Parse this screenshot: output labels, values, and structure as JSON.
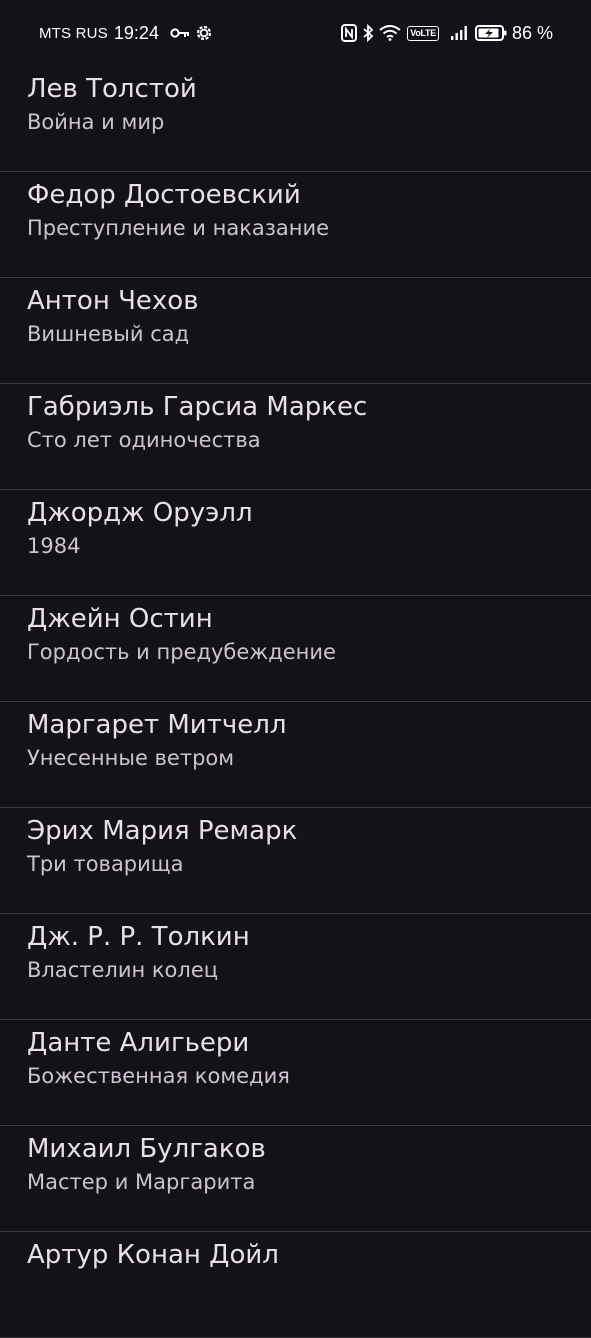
{
  "status_bar": {
    "carrier": "MTS RUS",
    "time": "19:24",
    "volte": "VoLTE",
    "battery_percent": "86 %"
  },
  "books": [
    {
      "author": "Лев Толстой",
      "title": "Война и мир"
    },
    {
      "author": "Федор Достоевский",
      "title": "Преступление и наказание"
    },
    {
      "author": "Антон Чехов",
      "title": "Вишневый сад"
    },
    {
      "author": "Габриэль Гарсиа Маркес",
      "title": "Сто лет одиночества"
    },
    {
      "author": "Джордж Оруэлл",
      "title": "1984"
    },
    {
      "author": "Джейн Остин",
      "title": "Гордость и предубеждение"
    },
    {
      "author": "Маргарет Митчелл",
      "title": "Унесенные ветром"
    },
    {
      "author": "Эрих Мария Ремарк",
      "title": "Три товарища"
    },
    {
      "author": "Дж. Р. Р. Толкин",
      "title": "Властелин колец"
    },
    {
      "author": "Данте Алигьери",
      "title": "Божественная комедия"
    },
    {
      "author": "Михаил Булгаков",
      "title": "Мастер и Маргарита"
    },
    {
      "author": "Артур Конан Дойл",
      "title": ""
    }
  ],
  "colors": {
    "background": "#141218",
    "title_text": "#e6e0e9",
    "subtitle_text": "#cac4d0",
    "divider": "#3a373e"
  }
}
